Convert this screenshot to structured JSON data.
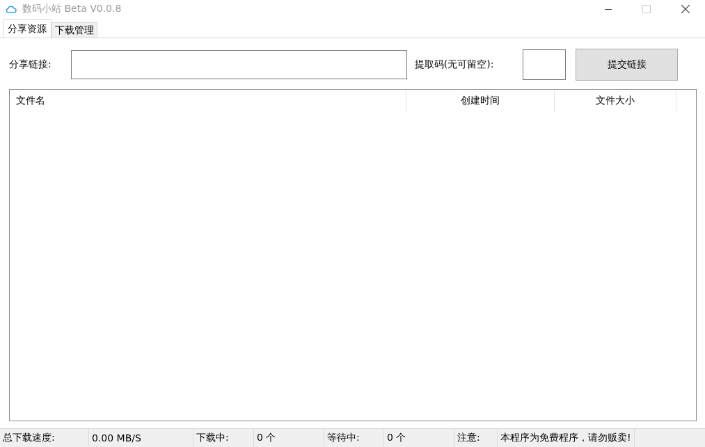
{
  "window": {
    "title": "数码小站 Beta V0.0.8"
  },
  "tabs": [
    {
      "label": "分享资源",
      "selected": true
    },
    {
      "label": "下载管理",
      "selected": false
    }
  ],
  "form": {
    "link_label": "分享链接:",
    "code_label": "提取码(无可留空):",
    "submit": "提交链接"
  },
  "table": {
    "columns": [
      "文件名",
      "创建时间",
      "文件大小"
    ]
  },
  "status_bar": [
    {
      "label": "总下载速度:",
      "value": "0.00 MB/S"
    },
    {
      "label": "下载中:",
      "value": "0 个"
    },
    {
      "label": "等待中:",
      "value": "0 个"
    },
    {
      "label": "注意:",
      "value": "本程序为免费程序，请勿贩卖!"
    }
  ]
}
